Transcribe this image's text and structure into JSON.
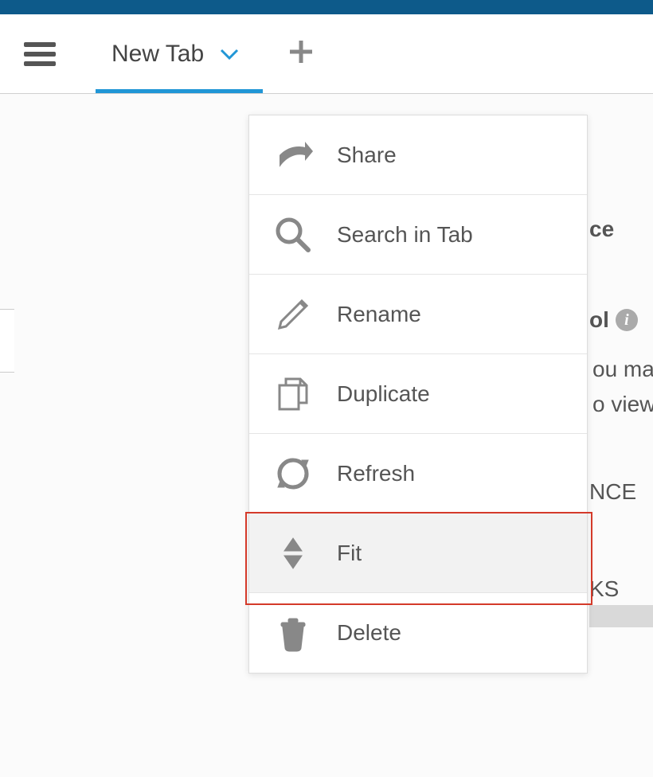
{
  "tab": {
    "label": "New Tab"
  },
  "menu": {
    "items": [
      {
        "label": "Share",
        "icon": "share-icon"
      },
      {
        "label": "Search in Tab",
        "icon": "search-icon"
      },
      {
        "label": "Rename",
        "icon": "pencil-icon"
      },
      {
        "label": "Duplicate",
        "icon": "duplicate-icon"
      },
      {
        "label": "Refresh",
        "icon": "refresh-icon"
      },
      {
        "label": "Fit",
        "icon": "fit-icon",
        "highlighted": true
      },
      {
        "label": "Delete",
        "icon": "trash-icon"
      }
    ]
  },
  "background": {
    "frag_ce": "ce",
    "frag_ol": "ol",
    "frag_uma": "ou ma",
    "frag_view": "o view",
    "frag_nce": "NCE",
    "frag_ks": "KS"
  }
}
